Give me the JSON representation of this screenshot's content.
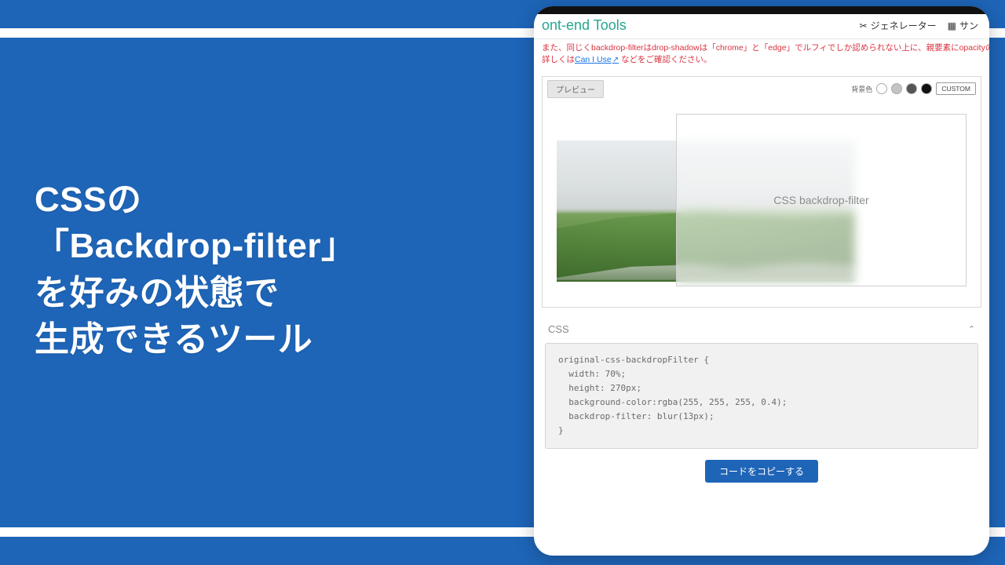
{
  "headline": {
    "line1": "CSSの",
    "line2": "「Backdrop-filter」",
    "line3": "を好みの状態で",
    "line4": "生成できるツール"
  },
  "app": {
    "brand": "ont-end Tools",
    "nav": {
      "generator": "ジェネレーター",
      "sample": "サン"
    },
    "warning": {
      "line1": "また、同じくbackdrop-filterはdrop-shadowは「chrome」と「edge」でルフィでしか認められない上に、親要素にopacityのプロパ",
      "prefix": "詳しくは",
      "link": "Can I Use",
      "suffix": " などをご確認ください。"
    },
    "preview": {
      "tab": "プレビュー",
      "bglabel": "背景色",
      "custom": "CUSTOM",
      "overlay_text": "CSS backdrop-filter"
    },
    "css": {
      "title": "CSS",
      "code": "original-css-backdropFilter {\n  width: 70%;\n  height: 270px;\n  background-color:rgba(255, 255, 255, 0.4);\n  backdrop-filter: blur(13px);\n}",
      "copy": "コードをコピーする"
    }
  }
}
